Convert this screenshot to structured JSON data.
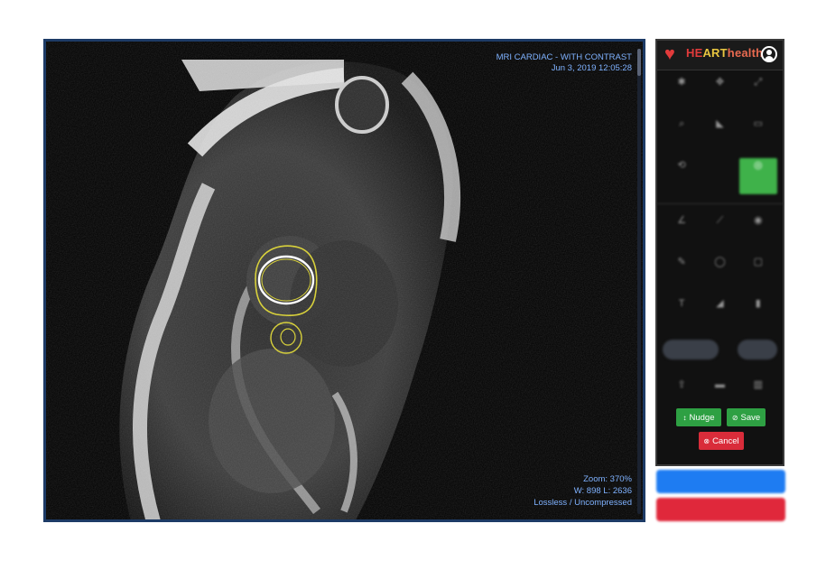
{
  "viewer": {
    "study_title": "MRI CARDIAC - WITH CONTRAST",
    "study_datetime": "Jun 3, 2019 12:05:28",
    "zoom_text": "Zoom: 370%",
    "window_level_text": "W: 898 L: 2636",
    "compression_text": "Lossless / Uncompressed"
  },
  "brand": {
    "name_part1": "HE",
    "name_part2": "ART",
    "name_part3": "health"
  },
  "actions": {
    "nudge_label": "Nudge",
    "save_label": "Save",
    "cancel_label": "Cancel"
  },
  "colors": {
    "accent_green": "#2ea043",
    "cancel_red": "#d92c3a",
    "accept_blue": "#1e7cf2",
    "close_red": "#e0283b",
    "overlay_text": "#7fb2ff",
    "contour_yellow": "#d9d23b"
  },
  "icons": {
    "nudge": "nudge-icon",
    "save": "check-circle-icon",
    "cancel": "x-circle-icon",
    "user": "user-avatar-icon",
    "logo": "heart-logo-icon"
  }
}
